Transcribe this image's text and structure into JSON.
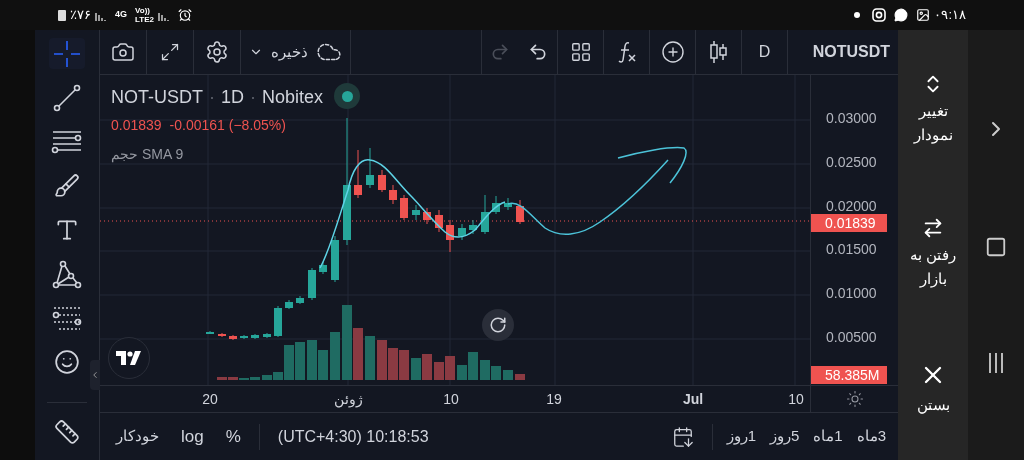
{
  "status_bar": {
    "battery": "٪۷۶",
    "network": "4G",
    "volte": "Vo))",
    "lte": "LTE2",
    "time": "۰۹:۱۸"
  },
  "drawing_tools": [
    {
      "kind": "crosshair",
      "selected": true
    },
    {
      "kind": "trend-line",
      "selected": false
    },
    {
      "kind": "parallel-lines",
      "selected": false
    },
    {
      "kind": "brush",
      "selected": false
    },
    {
      "kind": "text",
      "selected": false
    },
    {
      "kind": "pattern",
      "selected": false
    },
    {
      "kind": "fib",
      "selected": false
    },
    {
      "kind": "emoji",
      "selected": false
    }
  ],
  "toolbar": {
    "save_label": "ذخیره",
    "redo_disabled": true,
    "interval": "D",
    "symbol": "NOTUSDT"
  },
  "legend": {
    "symbol": "NOT-USDT",
    "separator_1": "·",
    "interval": "1D",
    "separator_2": "·",
    "exchange": "Nobitex",
    "price": "0.01839",
    "change": "-0.00161",
    "change_percent": "(−8.05%)",
    "indicator_label": "حجم",
    "indicator_name": "SMA 9"
  },
  "price_axis": {
    "ticks": [
      "0.03000",
      "0.02500",
      "0.02000",
      "0.01500",
      "0.01000",
      "0.00500"
    ],
    "last_price": "0.01839",
    "volume": "58.385M"
  },
  "time_axis": {
    "ticks": [
      {
        "label": "10",
        "bold": false
      },
      {
        "label": "Jul",
        "bold": true
      },
      {
        "label": "19",
        "bold": false
      },
      {
        "label": "10",
        "bold": false
      },
      {
        "label": "ژوئن",
        "bold": false
      },
      {
        "label": "20",
        "bold": false
      }
    ]
  },
  "bottom_bar": {
    "auto": "خودکار",
    "log": "log",
    "percent": "%",
    "clock": "(UTC+4:30) 10:18:53",
    "ranges": [
      "3ماه",
      "1ماه",
      "5روز",
      "1روز"
    ]
  },
  "side_panel": {
    "actions": [
      {
        "kind": "switch-chart",
        "label": "تغییر نمودار"
      },
      {
        "kind": "go-market",
        "label": "رفتن به بازار"
      },
      {
        "kind": "close",
        "label": "بستن"
      }
    ]
  }
}
